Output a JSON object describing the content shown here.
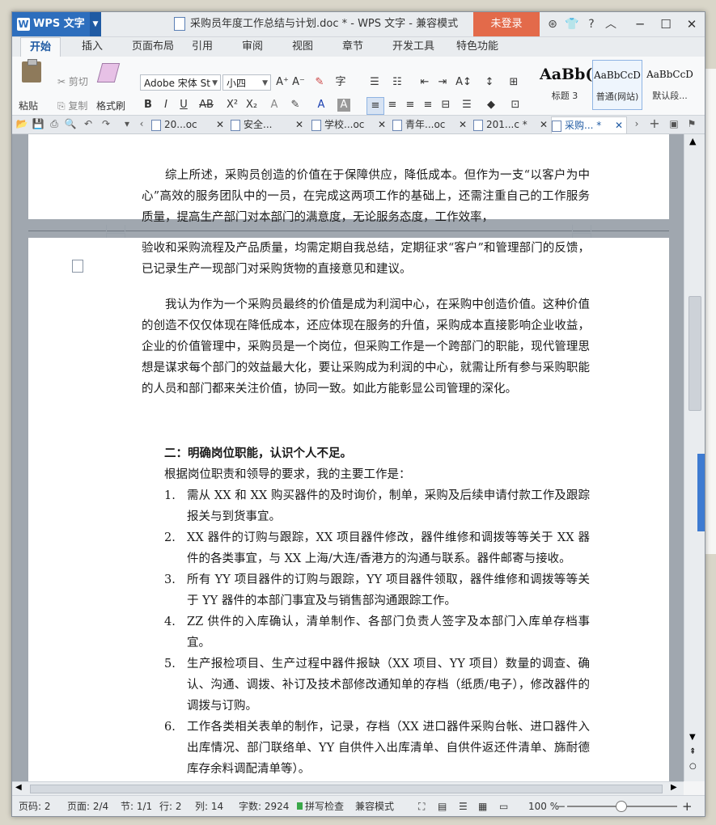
{
  "app": {
    "name": "WPS 文字",
    "window_title": "采购员年度工作总结与计划.doc * - WPS 文字 - 兼容模式",
    "login_button": "未登录"
  },
  "ribbon_tabs": [
    "开始",
    "插入",
    "页面布局",
    "引用",
    "审阅",
    "视图",
    "章节",
    "开发工具",
    "特色功能"
  ],
  "active_tab": "开始",
  "toolbar": {
    "paste_label": "粘贴",
    "cut_label": "剪切",
    "copy_label": "复制",
    "format_painter_label": "格式刷",
    "font_name": "Adobe 宋体 St",
    "font_size": "小四",
    "styles": [
      {
        "preview": "AaBb(",
        "label": "标题 3"
      },
      {
        "preview": "AaBbCcD",
        "label": "普通(网站)"
      },
      {
        "preview": "AaBbCcD",
        "label": "默认段..."
      }
    ]
  },
  "doc_tabs": [
    {
      "label": "20...oc",
      "active": false
    },
    {
      "label": "安全...",
      "active": false
    },
    {
      "label": "学校...oc",
      "active": false
    },
    {
      "label": "青年...oc",
      "active": false
    },
    {
      "label": "201...c *",
      "active": false
    },
    {
      "label": "采购... *",
      "active": true
    }
  ],
  "document": {
    "para1_top": "综上所述，采购员创造的价值在于保障供应，降低成本。但作为一支“以客户为中心”高效的服务团队中的一员，在完成这两项工作的基础上，还需注重自己的工作服务质量，提高生产部门对本部门的满意度，无论服务态度，工作效率，",
    "para1_bottom": "验收和采购流程及产品质量，均需定期自我总结，定期征求“客户”和管理部门的反馈，已记录生产一现部门对采购货物的直接意见和建议。",
    "para2": "我认为作为一个采购员最终的价值是成为利润中心，在采购中创造价值。这种价值的创造不仅仅体现在降低成本，还应体现在服务的升值，采购成本直接影响企业收益，企业的价值管理中，采购员是一个岗位，但采购工作是一个跨部门的职能，现代管理思想是谋求每个部门的效益最大化，要让采购成为利润的中心，就需让所有参与采购职能的人员和部门都来关注价值，协同一致。如此方能彰显公司管理的深化。",
    "heading": "二：明确岗位职能，认识个人不足。",
    "intro": "根据岗位职责和领导的要求，我的主要工作是：",
    "list": [
      {
        "num": "1.",
        "text": "需从 XX 和 XX 购买器件的及时询价，制单，采购及后续申请付款工作及跟踪报关与到货事宜。"
      },
      {
        "num": "2.",
        "text": "XX 器件的订购与跟踪，XX 项目器件修改，器件维修和调拨等等关于 XX 器件的各类事宜，与 XX 上海/大连/香港方的沟通与联系。器件邮寄与接收。"
      },
      {
        "num": "3.",
        "text": "所有 YY 项目器件的订购与跟踪，YY 项目器件领取，器件维修和调拨等等关于 YY 器件的本部门事宜及与销售部沟通跟踪工作。"
      },
      {
        "num": "4.",
        "text": "ZZ 供件的入库确认，清单制作、各部门负责人签字及本部门入库单存档事宜。"
      },
      {
        "num": "5.",
        "text": "生产报检项目、生产过程中器件报缺（XX 项目、YY 项目）数量的调查、确认、沟通、调拨、补订及技术部修改通知单的存档（纸质/电子），修改器件的调拨与订购。"
      },
      {
        "num": "6.",
        "text": "工作各类相关表单的制作，记录，存档（XX 进口器件采购台帐、进口器件入出库情况、部门联络单、YY 自供件入出库清单、自供件返还件清单、旆耐德库存余料调配清单等）。"
      }
    ]
  },
  "status_bar": {
    "page_num": "页码: 2",
    "pages": "页面: 2/4",
    "section": "节: 1/1",
    "row": "行: 2",
    "col": "列: 14",
    "word_count": "字数: 2924",
    "spell_check": "拼写检查",
    "compat_mode": "兼容模式",
    "zoom": "100 %"
  },
  "colors": {
    "accent": "#2d6ebd",
    "login": "#e36a4a"
  }
}
